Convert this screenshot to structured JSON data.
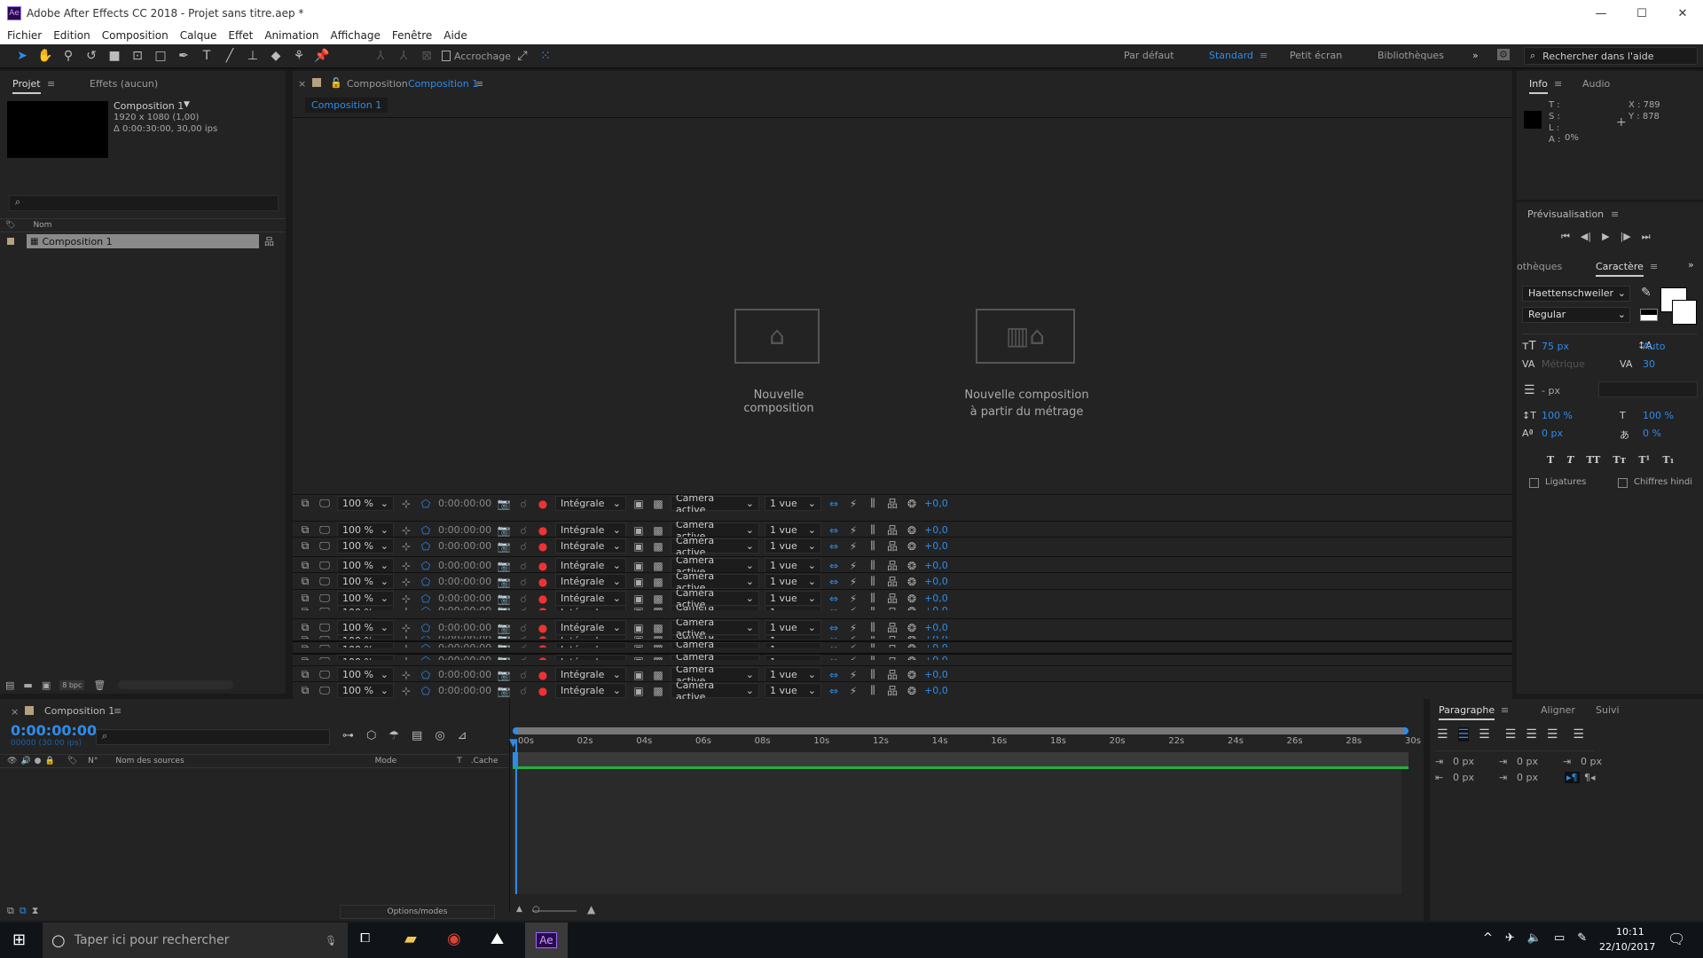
{
  "window": {
    "title": "Adobe After Effects CC 2018 - Projet sans titre.aep *",
    "logo": "Ae"
  },
  "menu": [
    "Fichier",
    "Edition",
    "Composition",
    "Calque",
    "Effet",
    "Animation",
    "Affichage",
    "Fenêtre",
    "Aide"
  ],
  "toolbar": {
    "snapping_label": "Accrochage"
  },
  "workspaces": {
    "items": [
      "Par défaut",
      "Standard",
      "Petit écran",
      "Bibliothèques"
    ],
    "active": "Standard",
    "search_placeholder": "Rechercher dans l'aide"
  },
  "project": {
    "tabs": [
      "Projet",
      "Effets  (aucun)"
    ],
    "comp_name": "Composition 1",
    "comp_size": "1920 x 1080 (1,00)",
    "comp_duration": "Δ 0:00:30:00, 30,00 ips",
    "column_name": "Nom",
    "items": [
      "Composition 1"
    ],
    "bpc": "8 bpc"
  },
  "viewer": {
    "tab_prefix": "Composition",
    "tab_name": "Composition 1",
    "sub_tab": "Composition 1",
    "new_comp": "Nouvelle composition",
    "new_comp_footage_1": "Nouvelle composition",
    "new_comp_footage_2": "à partir du métrage",
    "bar": {
      "zoom": "100 %",
      "time": "0:00:00:00",
      "resolution": "Intégrale",
      "camera": "Caméra active",
      "views": "1 vue",
      "exposure": "+0,0"
    }
  },
  "info": {
    "tabs": [
      "Info",
      "Audio"
    ],
    "t": "T :",
    "s": "S :",
    "l": "L :",
    "a": "A :",
    "a_val": "0%",
    "x": "X : 789",
    "y": "Y : 878"
  },
  "preview": {
    "title": "Prévisualisation"
  },
  "character": {
    "tabs": [
      "othèques",
      "Caractère"
    ],
    "font": "Haettenschweiler",
    "style": "Regular",
    "size": "75 px",
    "leading": "Auto",
    "kerning": "Métrique",
    "tracking": "30",
    "stroke": "- px",
    "vscale": "100 %",
    "hscale": "100 %",
    "baseline": "0 px",
    "tsume": "0 %",
    "ligatures": "Ligatures",
    "hindi": "Chiffres hindi"
  },
  "timeline": {
    "tab": "Composition 1",
    "time": "0:00:00:00",
    "frames": "00000 (30.00 ips)",
    "cols": {
      "num": "N°",
      "source": "Nom des sources",
      "mode": "Mode",
      "t": "T",
      "cache": ".Cache"
    },
    "ticks": [
      "00s",
      "02s",
      "04s",
      "06s",
      "08s",
      "10s",
      "12s",
      "14s",
      "16s",
      "18s",
      "20s",
      "22s",
      "24s",
      "26s",
      "28s",
      "30s"
    ],
    "options": "Options/modes"
  },
  "paragraph": {
    "tabs": [
      "Paragraphe",
      "Aligner",
      "Suivi"
    ],
    "values": [
      "0 px",
      "0 px",
      "0 px",
      "0 px",
      "0 px"
    ]
  },
  "taskbar": {
    "search": "Taper ici pour rechercher",
    "time": "10:11",
    "date": "22/10/2017"
  },
  "colors": {
    "accent": "#2d8ceb",
    "panel": "#232323",
    "comp_label": "#b4a17e",
    "work_area": "#1fb33c"
  }
}
